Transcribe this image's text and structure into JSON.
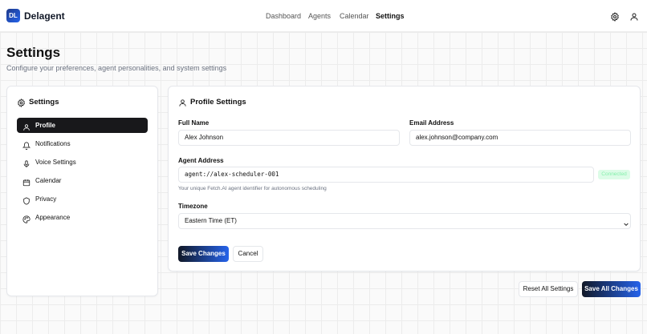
{
  "app": {
    "logo_initials": "DL",
    "name": "Delagent",
    "brand_color": "#2563eb"
  },
  "nav": {
    "items": [
      {
        "label": "Dashboard",
        "active": false
      },
      {
        "label": "Agents",
        "active": false
      },
      {
        "label": "Calendar",
        "active": false
      },
      {
        "label": "Settings",
        "active": true
      }
    ],
    "icons": [
      "gear-icon",
      "user-icon"
    ]
  },
  "page": {
    "title": "Settings",
    "subtitle": "Configure your preferences, agent personalities, and system settings"
  },
  "sidebar": {
    "title": "Settings",
    "items": [
      {
        "label": "Profile",
        "icon": "user-icon",
        "active": true
      },
      {
        "label": "Notifications",
        "icon": "bell-icon",
        "active": false
      },
      {
        "label": "Voice Settings",
        "icon": "microphone-icon",
        "active": false
      },
      {
        "label": "Calendar",
        "icon": "calendar-icon",
        "active": false
      },
      {
        "label": "Privacy",
        "icon": "shield-icon",
        "active": false
      },
      {
        "label": "Appearance",
        "icon": "palette-icon",
        "active": false
      }
    ]
  },
  "profile": {
    "title": "Profile Settings",
    "full_name_label": "Full Name",
    "full_name": "Alex Johnson",
    "email_label": "Email Address",
    "email": "alex.johnson@company.com",
    "agent_address_label": "Agent Address",
    "agent_address": "agent://alex-scheduler-001",
    "status_badge": "Connected",
    "agent_hint": "Your unique Fetch.AI agent identifier for autonomous scheduling",
    "timezone_label": "Timezone",
    "timezone": "Eastern Time (ET)",
    "save_label": "Save Changes",
    "cancel_label": "Cancel"
  },
  "footer": {
    "reset_label": "Reset All Settings",
    "save_all_label": "Save All Changes"
  }
}
